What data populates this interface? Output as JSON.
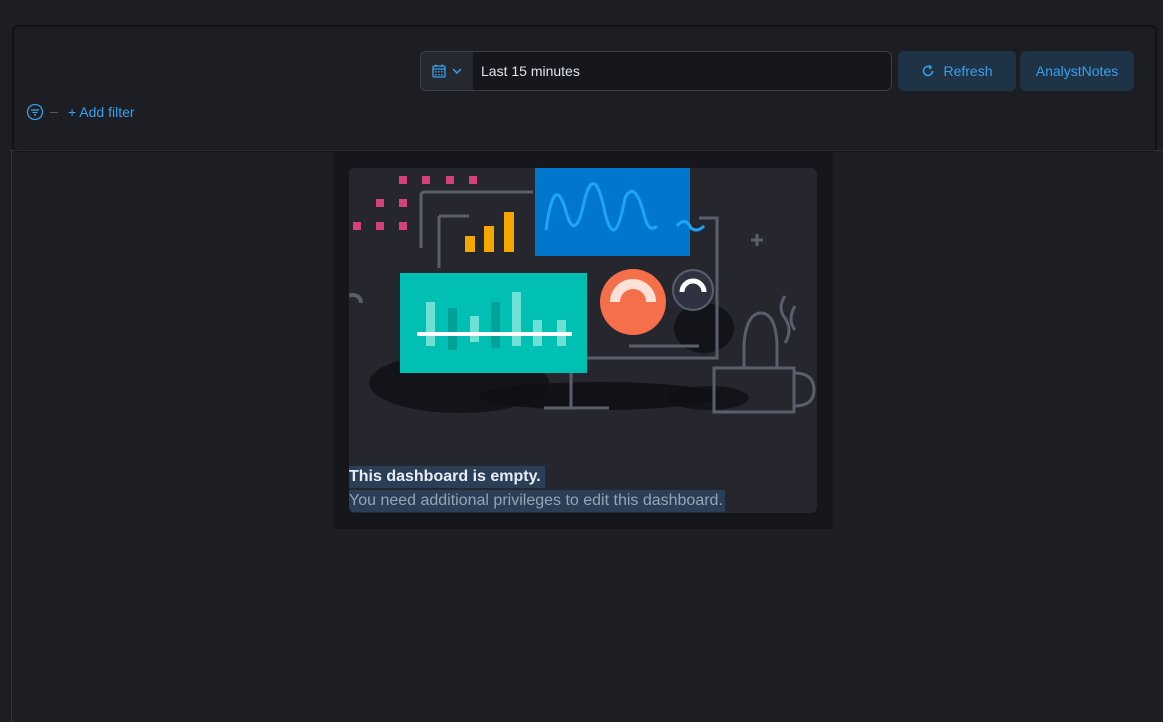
{
  "header": {
    "top_icons": [
      "globe-icon",
      "grid-icon",
      "trash-icon"
    ]
  },
  "query_bar": {
    "date_range": "Last 15 minutes",
    "refresh_label": "Refresh",
    "notes_label": "AnalystNotes",
    "add_filter_label": "+ Add filter"
  },
  "empty_state": {
    "title": "This dashboard is empty.",
    "description": "You need additional privileges to edit this dashboard."
  },
  "colors": {
    "accent": "#36a2ef",
    "background": "#1d1e24"
  }
}
